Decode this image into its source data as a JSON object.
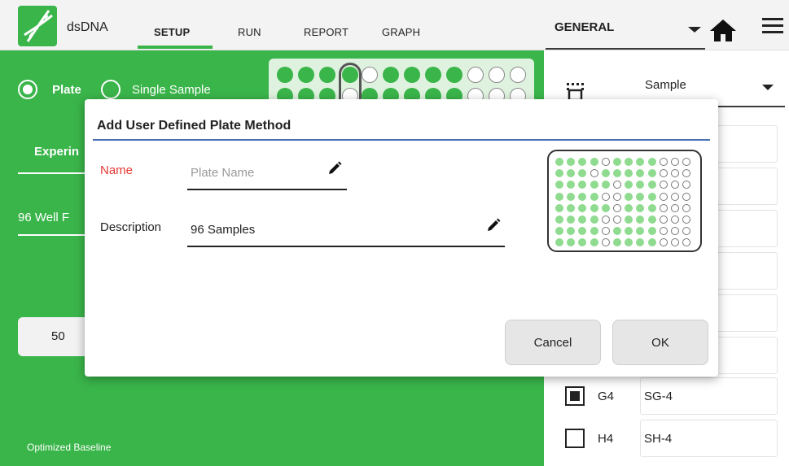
{
  "header": {
    "app_title": "dsDNA",
    "tabs": [
      {
        "label": "SETUP",
        "active": true
      },
      {
        "label": "RUN",
        "active": false
      },
      {
        "label": "REPORT",
        "active": false
      },
      {
        "label": "GRAPH",
        "active": false
      }
    ],
    "general_label": "GENERAL"
  },
  "left_panel": {
    "plate_radio_label": "Plate",
    "single_sample_label": "Single Sample",
    "experiment_label": "Experin",
    "well_format_label": "96 Well F",
    "volume_value": "50",
    "baseline_label": "Optimized Baseline"
  },
  "right_panel": {
    "sample_dropdown_value": "Sample",
    "rows": [
      {
        "well": "G4",
        "sample": "SG-4",
        "checked": true
      },
      {
        "well": "H4",
        "sample": "SH-4",
        "checked": false
      }
    ]
  },
  "dialog": {
    "title": "Add User Defined Plate Method",
    "name_label": "Name",
    "name_value": "",
    "name_placeholder": "Plate Name",
    "description_label": "Description",
    "description_value": "96 Samples",
    "cancel_label": "Cancel",
    "ok_label": "OK",
    "plate_map": {
      "rows": 8,
      "cols": 12,
      "empty_wells": [
        [
          0,
          4
        ],
        [
          0,
          9
        ],
        [
          0,
          10
        ],
        [
          0,
          11
        ],
        [
          1,
          3
        ],
        [
          1,
          9
        ],
        [
          1,
          10
        ],
        [
          1,
          11
        ],
        [
          2,
          5
        ],
        [
          2,
          9
        ],
        [
          2,
          10
        ],
        [
          2,
          11
        ],
        [
          3,
          4
        ],
        [
          3,
          5
        ],
        [
          3,
          9
        ],
        [
          3,
          10
        ],
        [
          3,
          11
        ],
        [
          4,
          5
        ],
        [
          4,
          9
        ],
        [
          4,
          10
        ],
        [
          4,
          11
        ],
        [
          5,
          4
        ],
        [
          5,
          5
        ],
        [
          5,
          9
        ],
        [
          5,
          10
        ],
        [
          5,
          11
        ],
        [
          6,
          4
        ],
        [
          6,
          9
        ],
        [
          6,
          10
        ],
        [
          6,
          11
        ],
        [
          7,
          4
        ],
        [
          7,
          9
        ],
        [
          7,
          10
        ],
        [
          7,
          11
        ]
      ]
    }
  },
  "colors": {
    "accent_green": "#3ab54a",
    "required_red": "#e53935",
    "divider_blue": "#4a6fb0"
  }
}
